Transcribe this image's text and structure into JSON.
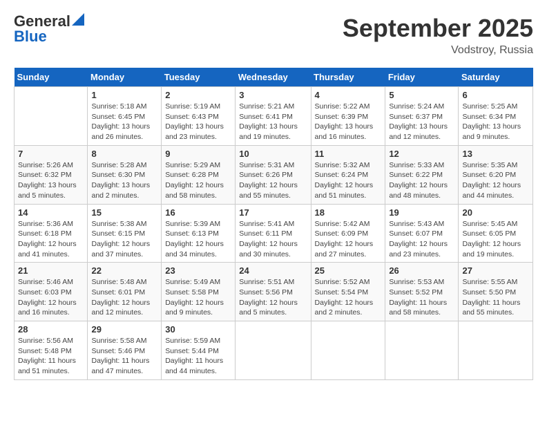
{
  "header": {
    "logo_general": "General",
    "logo_blue": "Blue",
    "month": "September 2025",
    "location": "Vodstroy, Russia"
  },
  "columns": [
    "Sunday",
    "Monday",
    "Tuesday",
    "Wednesday",
    "Thursday",
    "Friday",
    "Saturday"
  ],
  "weeks": [
    [
      {
        "day": "",
        "info": ""
      },
      {
        "day": "1",
        "info": "Sunrise: 5:18 AM\nSunset: 6:45 PM\nDaylight: 13 hours\nand 26 minutes."
      },
      {
        "day": "2",
        "info": "Sunrise: 5:19 AM\nSunset: 6:43 PM\nDaylight: 13 hours\nand 23 minutes."
      },
      {
        "day": "3",
        "info": "Sunrise: 5:21 AM\nSunset: 6:41 PM\nDaylight: 13 hours\nand 19 minutes."
      },
      {
        "day": "4",
        "info": "Sunrise: 5:22 AM\nSunset: 6:39 PM\nDaylight: 13 hours\nand 16 minutes."
      },
      {
        "day": "5",
        "info": "Sunrise: 5:24 AM\nSunset: 6:37 PM\nDaylight: 13 hours\nand 12 minutes."
      },
      {
        "day": "6",
        "info": "Sunrise: 5:25 AM\nSunset: 6:34 PM\nDaylight: 13 hours\nand 9 minutes."
      }
    ],
    [
      {
        "day": "7",
        "info": "Sunrise: 5:26 AM\nSunset: 6:32 PM\nDaylight: 13 hours\nand 5 minutes."
      },
      {
        "day": "8",
        "info": "Sunrise: 5:28 AM\nSunset: 6:30 PM\nDaylight: 13 hours\nand 2 minutes."
      },
      {
        "day": "9",
        "info": "Sunrise: 5:29 AM\nSunset: 6:28 PM\nDaylight: 12 hours\nand 58 minutes."
      },
      {
        "day": "10",
        "info": "Sunrise: 5:31 AM\nSunset: 6:26 PM\nDaylight: 12 hours\nand 55 minutes."
      },
      {
        "day": "11",
        "info": "Sunrise: 5:32 AM\nSunset: 6:24 PM\nDaylight: 12 hours\nand 51 minutes."
      },
      {
        "day": "12",
        "info": "Sunrise: 5:33 AM\nSunset: 6:22 PM\nDaylight: 12 hours\nand 48 minutes."
      },
      {
        "day": "13",
        "info": "Sunrise: 5:35 AM\nSunset: 6:20 PM\nDaylight: 12 hours\nand 44 minutes."
      }
    ],
    [
      {
        "day": "14",
        "info": "Sunrise: 5:36 AM\nSunset: 6:18 PM\nDaylight: 12 hours\nand 41 minutes."
      },
      {
        "day": "15",
        "info": "Sunrise: 5:38 AM\nSunset: 6:15 PM\nDaylight: 12 hours\nand 37 minutes."
      },
      {
        "day": "16",
        "info": "Sunrise: 5:39 AM\nSunset: 6:13 PM\nDaylight: 12 hours\nand 34 minutes."
      },
      {
        "day": "17",
        "info": "Sunrise: 5:41 AM\nSunset: 6:11 PM\nDaylight: 12 hours\nand 30 minutes."
      },
      {
        "day": "18",
        "info": "Sunrise: 5:42 AM\nSunset: 6:09 PM\nDaylight: 12 hours\nand 27 minutes."
      },
      {
        "day": "19",
        "info": "Sunrise: 5:43 AM\nSunset: 6:07 PM\nDaylight: 12 hours\nand 23 minutes."
      },
      {
        "day": "20",
        "info": "Sunrise: 5:45 AM\nSunset: 6:05 PM\nDaylight: 12 hours\nand 19 minutes."
      }
    ],
    [
      {
        "day": "21",
        "info": "Sunrise: 5:46 AM\nSunset: 6:03 PM\nDaylight: 12 hours\nand 16 minutes."
      },
      {
        "day": "22",
        "info": "Sunrise: 5:48 AM\nSunset: 6:01 PM\nDaylight: 12 hours\nand 12 minutes."
      },
      {
        "day": "23",
        "info": "Sunrise: 5:49 AM\nSunset: 5:58 PM\nDaylight: 12 hours\nand 9 minutes."
      },
      {
        "day": "24",
        "info": "Sunrise: 5:51 AM\nSunset: 5:56 PM\nDaylight: 12 hours\nand 5 minutes."
      },
      {
        "day": "25",
        "info": "Sunrise: 5:52 AM\nSunset: 5:54 PM\nDaylight: 12 hours\nand 2 minutes."
      },
      {
        "day": "26",
        "info": "Sunrise: 5:53 AM\nSunset: 5:52 PM\nDaylight: 11 hours\nand 58 minutes."
      },
      {
        "day": "27",
        "info": "Sunrise: 5:55 AM\nSunset: 5:50 PM\nDaylight: 11 hours\nand 55 minutes."
      }
    ],
    [
      {
        "day": "28",
        "info": "Sunrise: 5:56 AM\nSunset: 5:48 PM\nDaylight: 11 hours\nand 51 minutes."
      },
      {
        "day": "29",
        "info": "Sunrise: 5:58 AM\nSunset: 5:46 PM\nDaylight: 11 hours\nand 47 minutes."
      },
      {
        "day": "30",
        "info": "Sunrise: 5:59 AM\nSunset: 5:44 PM\nDaylight: 11 hours\nand 44 minutes."
      },
      {
        "day": "",
        "info": ""
      },
      {
        "day": "",
        "info": ""
      },
      {
        "day": "",
        "info": ""
      },
      {
        "day": "",
        "info": ""
      }
    ]
  ]
}
